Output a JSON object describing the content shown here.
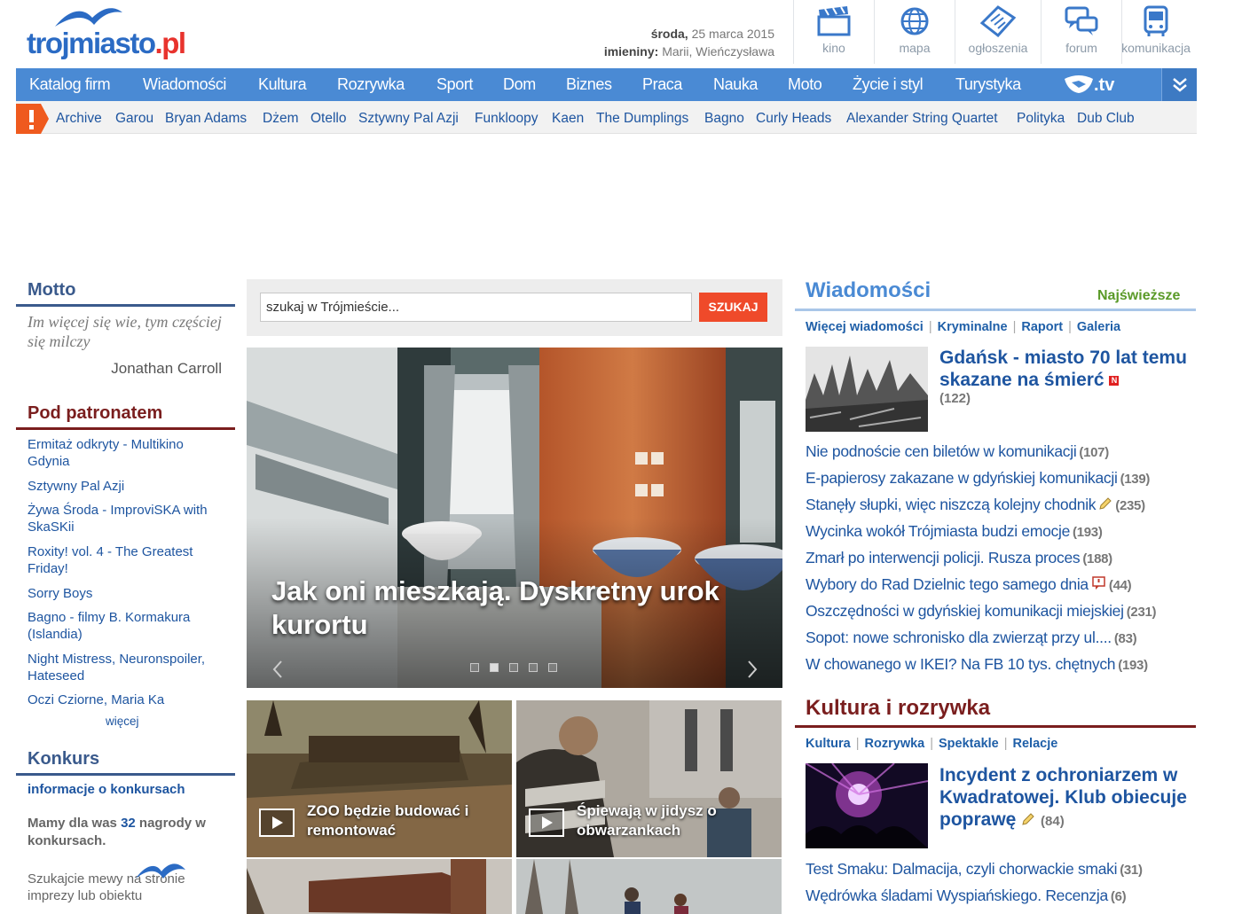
{
  "header": {
    "logo_text": "trojmiasto",
    "logo_suffix": ".pl",
    "date_day": "środa,",
    "date_text": "25 marca 2015",
    "nameday_label": "imieniny:",
    "nameday_names": "Marii, Wieńczysława",
    "tools": [
      {
        "label": "kino",
        "icon": "clapperboard-icon"
      },
      {
        "label": "mapa",
        "icon": "globe-icon"
      },
      {
        "label": "ogłoszenia",
        "icon": "newspaper-icon"
      },
      {
        "label": "forum",
        "icon": "chat-bubbles-icon"
      },
      {
        "label": "komunikacja",
        "icon": "bus-icon"
      }
    ]
  },
  "nav": {
    "items": [
      "Katalog firm",
      "Wiadomości",
      "Kultura",
      "Rozrywka",
      "Sport",
      "Dom",
      "Biznes",
      "Praca",
      "Nauka",
      "Moto",
      "Życie i styl",
      "Turystyka"
    ],
    "tv_label": ".tv",
    "accent": "#4a8ad4"
  },
  "tags": {
    "alert_symbol": "!",
    "items": [
      "Archive",
      "Garou",
      "Bryan Adams",
      "Dżem",
      "Otello",
      "Sztywny Pal Azji",
      "Funkloopy",
      "Kaen",
      "The Dumplings",
      "Bagno",
      "Curly Heads",
      "Alexander String Quartet",
      "Polityka",
      "Dub Club"
    ]
  },
  "motto": {
    "title": "Motto",
    "quote": "Im więcej się wie, tym częściej się milczy",
    "author": "Jonathan Carroll",
    "color": "#3a5a8c"
  },
  "patronage": {
    "title": "Pod patronatem",
    "color": "#7a1e1e",
    "items": [
      "Ermitaż odkryty - Multikino Gdynia",
      "Sztywny Pal Azji",
      "Żywa Środa - ImproviSKA with SkaSKii",
      "Roxity! vol. 4 - The Greatest Friday!",
      "Sorry Boys",
      "Bagno - filmy B. Kormakura (Islandia)",
      "Night Mistress, Neuronspoiler, Hateseed",
      "Oczi Cziorne, Maria Ka"
    ],
    "more": "więcej"
  },
  "contest": {
    "title": "Konkurs",
    "info": "informacje o konkursach",
    "prize_before": "Mamy dla was",
    "prize_count": "32",
    "prize_after": "nagrody w konkursach.",
    "seek_text": "Szukajcie mewy na stronie imprezy lub obiektu"
  },
  "search": {
    "placeholder": "szukaj w Trójmieście...",
    "button": "SZUKAJ"
  },
  "hero": {
    "caption": "Jak oni mieszkają. Dyskretny urok kurortu",
    "slides": 5,
    "active_slide": 2
  },
  "tiles": [
    {
      "caption": "ZOO będzie budować i remontować"
    },
    {
      "caption": "Śpiewają w jidysz o obwarzankach"
    }
  ],
  "news": {
    "title": "Wiadomości",
    "latest": "Najświeższe",
    "sublinks": [
      "Więcej wiadomości",
      "Kryminalne",
      "Raport",
      "Galeria"
    ],
    "lead_title": "Gdańsk - miasto 70 lat temu skazane na śmierć",
    "lead_badge": "N",
    "lead_count": "(122)",
    "items": [
      {
        "title": "Nie podnoście cen biletów w komunikacji",
        "count": "(107)"
      },
      {
        "title": "E-papierosy zakazane w gdyńskiej komunikacji",
        "count": "(139)"
      },
      {
        "title": "Stanęły słupki, więc niszczą kolejny chodnik",
        "count": "(235)"
      },
      {
        "title": "Wycinka wokół Trójmiasta budzi emocje",
        "count": "(193)"
      },
      {
        "title": "Zmarł po interwencji policji. Rusza proces",
        "count": "(188)"
      },
      {
        "title": "Wybory do Rad Dzielnic tego samego dnia",
        "count": "(44)"
      },
      {
        "title": "Oszczędności w gdyńskiej komunikacji miejskiej",
        "count": "(231)"
      },
      {
        "title": "Sopot: nowe schronisko dla zwierząt przy ul....",
        "count": "(83)"
      },
      {
        "title": "W chowanego w IKEI? Na FB 10 tys. chętnych",
        "count": "(193)"
      }
    ]
  },
  "culture": {
    "title": "Kultura i rozrywka",
    "sublinks": [
      "Kultura",
      "Rozrywka",
      "Spektakle",
      "Relacje"
    ],
    "lead_title": "Incydent z ochroniarzem w Kwadratowej. Klub obiecuje poprawę",
    "lead_count": "(84)",
    "items": [
      {
        "title": "Test Smaku: Dalmacija, czyli chorwackie smaki",
        "count": "(31)"
      },
      {
        "title": "Wędrówka śladami Wyspiańskiego. Recenzja",
        "count": "(6)"
      }
    ]
  }
}
